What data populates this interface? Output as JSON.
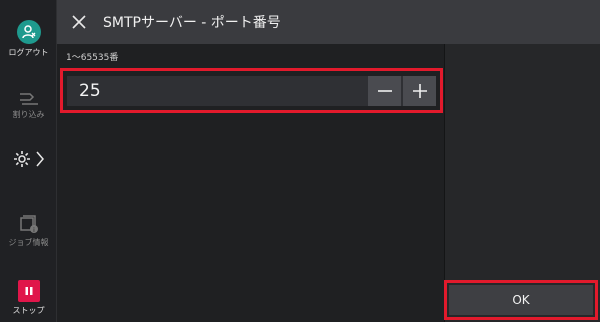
{
  "rail": {
    "logout_label": "ログアウト",
    "interrupt_label": "割り込み",
    "job_status_label": "ジョブ情報",
    "stop_label": "ストップ"
  },
  "header": {
    "title": "SMTPサーバー - ポート番号"
  },
  "port_field": {
    "range_hint": "1〜65535番",
    "value": "25",
    "decrement_icon": "minus-icon",
    "increment_icon": "plus-icon"
  },
  "actions": {
    "ok_label": "OK"
  },
  "colors": {
    "accent_teal": "#1e9a8e",
    "stop_red": "#e0164a",
    "highlight_red": "#e21a2c"
  }
}
